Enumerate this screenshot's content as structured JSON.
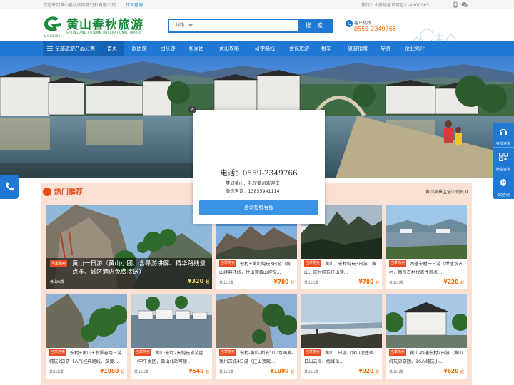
{
  "topbar": {
    "welcome": "欢迎来到黄山春秋国际旅行社有限公司",
    "login": "订单查询",
    "license": "旅行社业务经营许可证 L-AH00063"
  },
  "logo": {
    "title": "黄山春秋旅游",
    "english": "SPRING AND AUTUMN INTERNATIONAL TRAVEL",
    "code": "L-AH00063"
  },
  "search": {
    "category": "线路",
    "placeholder": "",
    "button": "搜 索"
  },
  "hotline": {
    "label": "客户热线",
    "number": "0559-2349766"
  },
  "nav": {
    "all_categories": "全部旅游产品分类",
    "items": [
      "首页",
      "跟团游",
      "团队游",
      "私家团",
      "黄山攻略",
      "研学路线",
      "会议旅游",
      "租车",
      "旅游指南",
      "导游",
      "企业简介"
    ]
  },
  "banner": {
    "caption": "黄山风景区全山幼员 II"
  },
  "right_float": [
    "在线咨询",
    "微信咨询",
    "QQ咨询"
  ],
  "popup": {
    "close": "×",
    "tel": "电话：0559-2349766",
    "line1": "梦幻黄山、礼仪徽州欢迎您",
    "line2": "微信咨询：13855941114",
    "cta": "咨询在线客服"
  },
  "hot": {
    "title": "热门推荐",
    "big": {
      "tag": "当季热卖",
      "title": "黄山一日游（黄山小团、含导游讲解、精华路线景点多、城区酒店免费接送）",
      "depart": "黄山出发",
      "price": "¥320",
      "unit": "起"
    },
    "cards": [
      {
        "tag": "当季热卖",
        "title": "宏村+黄山纯玩3日游（黄山经典环线，住山顶黄山宾馆…",
        "depart": "黄山出发",
        "price": "¥780",
        "unit": "起"
      },
      {
        "tag": "当季热卖",
        "title": "黄山、宏村纯玩3日游（黄山、宏村纯玩往山顶…",
        "depart": "黄山出发",
        "price": "¥780",
        "unit": "起"
      },
      {
        "tag": "当季热卖",
        "title": "西递宏村一日游（世遗双古村，徽州古村代表性景点…",
        "depart": "黄山出发",
        "price": "¥220",
        "unit": "起"
      },
      {
        "tag": "当季热卖",
        "title": "宏村+黄山+翡翠谷两日游纯玩2日游（人气经典路线、深度…",
        "depart": "黄山出发",
        "price": "¥1080",
        "unit": "起"
      },
      {
        "tag": "当季热卖",
        "title": "黄山·宏村2天纯玩旅游团（中午发团，黄山北站可接…",
        "depart": "黄山出发",
        "price": "¥540",
        "unit": "起"
      },
      {
        "tag": "当季热卖",
        "title": "宏村-黄山-新安江山水画廊-徽州古城4日游（往山顶观…",
        "depart": "黄山出发",
        "price": "¥1000",
        "unit": "起"
      },
      {
        "tag": "当季热卖",
        "title": "黄山二日游（含山顶住宿、日出云海、梅峰岳…",
        "depart": "黄山出发",
        "price": "¥920",
        "unit": "起"
      },
      {
        "tag": "当季热卖",
        "title": "黄山-西递宏村2日游（黄山纯玩旅游团、16人纯玩小…",
        "depart": "黄山出发",
        "price": "¥620",
        "unit": "起"
      }
    ]
  },
  "colors": {
    "primary": "#1e78d4",
    "accent": "#e84c1f",
    "price": "#ff6a00",
    "logo": "#1a8a3a"
  }
}
